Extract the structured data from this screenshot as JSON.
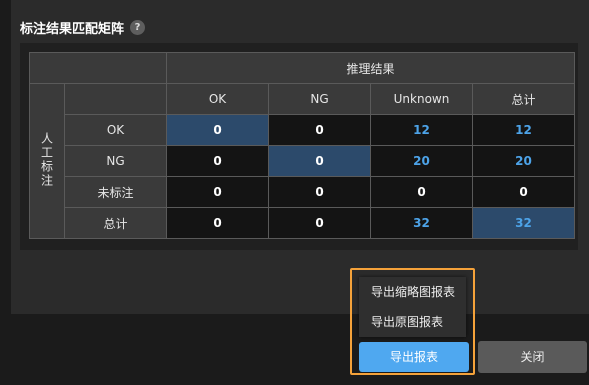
{
  "section": {
    "title": "标注结果匹配矩阵",
    "help": "?"
  },
  "matrix": {
    "column_group_label": "推理结果",
    "row_group_label": "人工标注",
    "columns": [
      "OK",
      "NG",
      "Unknown",
      "总计"
    ],
    "rows": [
      {
        "label": "OK",
        "values": [
          "0",
          "0",
          "12",
          "12"
        ]
      },
      {
        "label": "NG",
        "values": [
          "0",
          "0",
          "20",
          "20"
        ]
      },
      {
        "label": "未标注",
        "values": [
          "0",
          "0",
          "0",
          "0"
        ]
      },
      {
        "label": "总计",
        "values": [
          "0",
          "0",
          "32",
          "32"
        ]
      }
    ]
  },
  "export_menu": {
    "items": [
      "导出缩略图报表",
      "导出原图报表"
    ]
  },
  "buttons": {
    "export": "导出报表",
    "close": "关闭"
  },
  "colors": {
    "accent": "#4fa8f0",
    "highlight_frame": "#f5a23a",
    "diagonal_cell": "#2c4a6b",
    "numeric_blue": "#4da3e8"
  }
}
